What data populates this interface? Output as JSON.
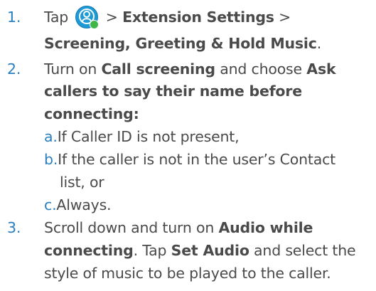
{
  "steps": [
    {
      "number": "1.",
      "lines": [
        {
          "parts": [
            "Tap",
            "",
            ">",
            "Extension Settings",
            ">"
          ]
        },
        {
          "parts": [
            "Screening, Greeting & Hold Music",
            "."
          ]
        }
      ]
    },
    {
      "number": "2.",
      "lines": [
        {
          "parts": [
            "Turn on",
            "Call screening",
            "and choose",
            "Ask"
          ]
        },
        {
          "parts": [
            "callers to say their name before"
          ]
        },
        {
          "parts": [
            "connecting:"
          ]
        }
      ],
      "options": [
        {
          "letter": "a.",
          "lines": [
            "If Caller ID is not present,"
          ]
        },
        {
          "letter": "b.",
          "lines": [
            "If the caller is not in the user’s Contact",
            "list, or"
          ]
        },
        {
          "letter": "c.",
          "lines": [
            "Always."
          ]
        }
      ]
    },
    {
      "number": "3.",
      "lines": [
        {
          "parts": [
            "Scroll down and turn on",
            "Audio while"
          ]
        },
        {
          "parts": [
            "connecting",
            ". Tap",
            "Set Audio",
            "and select the"
          ]
        },
        {
          "parts": [
            "style of music to be played to the caller."
          ]
        }
      ]
    }
  ],
  "icons": {
    "app_icon": "user-circle-icon",
    "status_dot": "green-presence-dot"
  },
  "colors": {
    "number": "#2a7fc0",
    "text": "#4a4a4a",
    "icon_bg": "#1d9ad6",
    "presence": "#40b649"
  }
}
